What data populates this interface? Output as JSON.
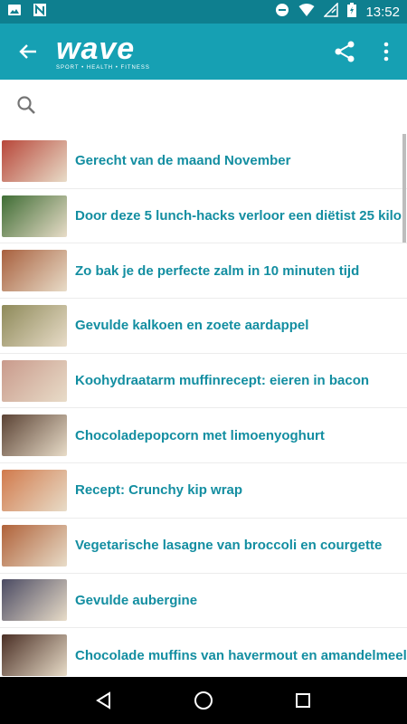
{
  "status_bar": {
    "time": "13:52",
    "left_icons": [
      "image-icon",
      "n-icon"
    ],
    "right_icons": [
      "do-not-disturb-icon",
      "wifi-icon",
      "signal-icon",
      "battery-charging-icon"
    ]
  },
  "app_bar": {
    "logo_word": "wave",
    "logo_tagline": "SPORT • HEALTH • FITNESS",
    "accent_color": "#16a0b3"
  },
  "search": {
    "placeholder": ""
  },
  "articles": [
    {
      "title": "Gerecht van de maand November",
      "thumb_color": "#b8473a"
    },
    {
      "title": "Door deze 5 lunch-hacks verloor een diëtist 25 kilo",
      "thumb_color": "#3f6d35"
    },
    {
      "title": "Zo bak je de perfecte zalm in 10 minuten tijd",
      "thumb_color": "#a8603e"
    },
    {
      "title": "Gevulde kalkoen en zoete aardappel",
      "thumb_color": "#8e8a5a"
    },
    {
      "title": "Koohydraatarm muffinrecept: eieren in bacon",
      "thumb_color": "#c99a8c"
    },
    {
      "title": "Chocoladepopcorn met limoenyoghurt",
      "thumb_color": "#5b4335"
    },
    {
      "title": "Recept: Crunchy kip wrap",
      "thumb_color": "#d17a4c"
    },
    {
      "title": "Vegetarische lasagne van broccoli en courgette",
      "thumb_color": "#b0623a"
    },
    {
      "title": "Gevulde aubergine",
      "thumb_color": "#4b4b63"
    },
    {
      "title": "Chocolade muffins van havermout en amandelmeel",
      "thumb_color": "#4a2f25"
    }
  ]
}
